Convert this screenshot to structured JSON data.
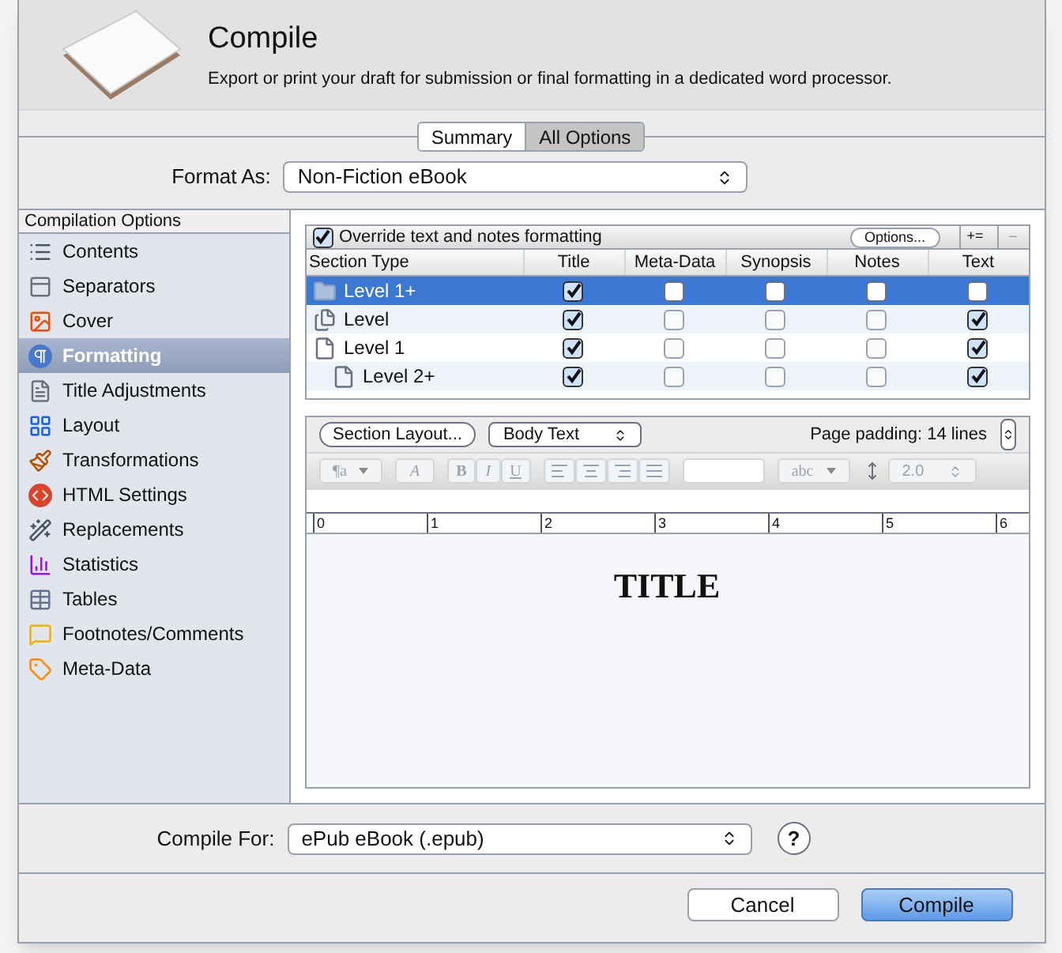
{
  "header": {
    "title": "Compile",
    "subtitle": "Export or print your draft for submission or final formatting in a dedicated word processor."
  },
  "tabs": [
    {
      "label": "Summary",
      "selected": false
    },
    {
      "label": "All Options",
      "selected": true
    }
  ],
  "format_as": {
    "label": "Format As:",
    "value": "Non-Fiction eBook"
  },
  "sidebar": {
    "heading": "Compilation Options",
    "items": [
      {
        "label": "Contents",
        "selected": false
      },
      {
        "label": "Separators",
        "selected": false
      },
      {
        "label": "Cover",
        "selected": false
      },
      {
        "label": "Formatting",
        "selected": true
      },
      {
        "label": "Title Adjustments",
        "selected": false
      },
      {
        "label": "Layout",
        "selected": false
      },
      {
        "label": "Transformations",
        "selected": false
      },
      {
        "label": "HTML Settings",
        "selected": false
      },
      {
        "label": "Replacements",
        "selected": false
      },
      {
        "label": "Statistics",
        "selected": false
      },
      {
        "label": "Tables",
        "selected": false
      },
      {
        "label": "Footnotes/Comments",
        "selected": false
      },
      {
        "label": "Meta-Data",
        "selected": false
      }
    ]
  },
  "override": {
    "label": "Override text and notes formatting",
    "checked": true,
    "options_button": "Options...",
    "add_button": "+=",
    "remove_button": "−"
  },
  "table": {
    "columns": [
      "Section Type",
      "Title",
      "Meta-Data",
      "Synopsis",
      "Notes",
      "Text"
    ],
    "rows": [
      {
        "label": "Level  1+",
        "kind": "folder",
        "selected": true,
        "checks": [
          true,
          false,
          false,
          false,
          false
        ]
      },
      {
        "label": "Level",
        "kind": "stack",
        "selected": false,
        "checks": [
          true,
          false,
          false,
          false,
          true
        ]
      },
      {
        "label": "Level  1",
        "kind": "document",
        "selected": false,
        "checks": [
          true,
          false,
          false,
          false,
          true
        ],
        "children": [
          {
            "label": "Level  2+",
            "kind": "document",
            "selected": false,
            "checks": [
              true,
              false,
              false,
              false,
              true
            ]
          }
        ]
      }
    ]
  },
  "editor": {
    "section_layout_button": "Section Layout...",
    "style_select": "Body Text",
    "page_padding": "Page padding: 14 lines",
    "toolbar": [
      {
        "kind": "select",
        "label": "¶a"
      },
      {
        "kind": "button",
        "label": "A"
      },
      {
        "kind": "group",
        "labels": [
          "B",
          "I",
          "U"
        ]
      },
      {
        "kind": "align"
      },
      {
        "kind": "color"
      },
      {
        "kind": "select",
        "label": "abc"
      },
      {
        "kind": "spacing",
        "label": "2.0"
      }
    ],
    "ruler": [
      "0",
      "1",
      "2",
      "3",
      "4",
      "5",
      "6"
    ],
    "preview_title": "TITLE"
  },
  "compile_for": {
    "label": "Compile For:",
    "value": "ePub eBook (.epub)",
    "help": "?"
  },
  "buttons": [
    {
      "label": "Cancel",
      "kind": "secondary"
    },
    {
      "label": "Compile",
      "kind": "primary"
    }
  ]
}
